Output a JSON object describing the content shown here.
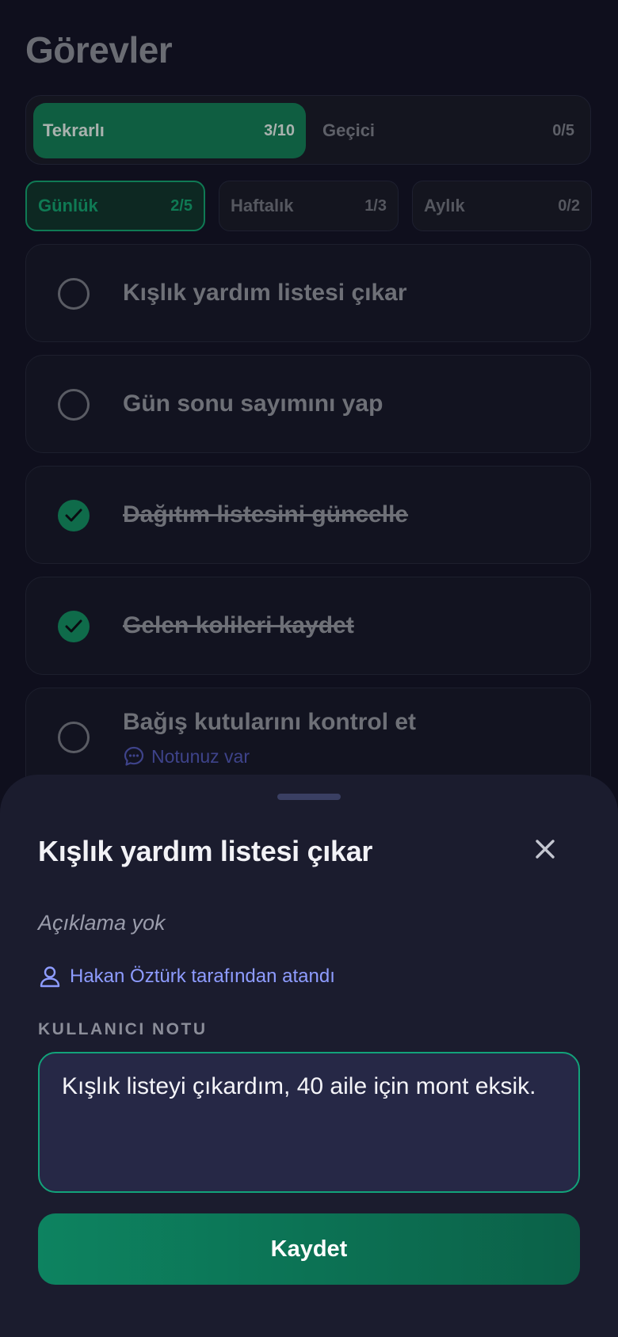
{
  "page": {
    "title": "Görevler"
  },
  "tabs": [
    {
      "label": "Tekrarlı",
      "count": "3/10",
      "active": true
    },
    {
      "label": "Geçici",
      "count": "0/5",
      "active": false
    }
  ],
  "period_filters": [
    {
      "label": "Günlük",
      "count": "2/5",
      "active": true
    },
    {
      "label": "Haftalık",
      "count": "1/3",
      "active": false
    },
    {
      "label": "Aylık",
      "count": "0/2",
      "active": false
    }
  ],
  "tasks": [
    {
      "label": "Kışlık yardım listesi çıkar",
      "done": false
    },
    {
      "label": "Gün sonu sayımını yap",
      "done": false
    },
    {
      "label": "Dağıtım listesini güncelle",
      "done": true
    },
    {
      "label": "Gelen kolileri kaydet",
      "done": true
    },
    {
      "label": "Bağış kutularını kontrol et",
      "done": false,
      "note": "Notunuz var"
    }
  ],
  "sheet": {
    "title": "Kışlık yardım listesi çıkar",
    "description": "Açıklama yok",
    "assigned_by": "Hakan Öztürk tarafından atandı",
    "note_label": "KULLANICI NOTU",
    "note_value": "Kışlık listeyi çıkardım, 40 aile için mont eksik.",
    "save_label": "Kaydet"
  },
  "colors": {
    "accent": "#0f7a54",
    "link": "#8e9cff",
    "background": "#0f0f1d",
    "sheet": "#1b1c2e"
  }
}
